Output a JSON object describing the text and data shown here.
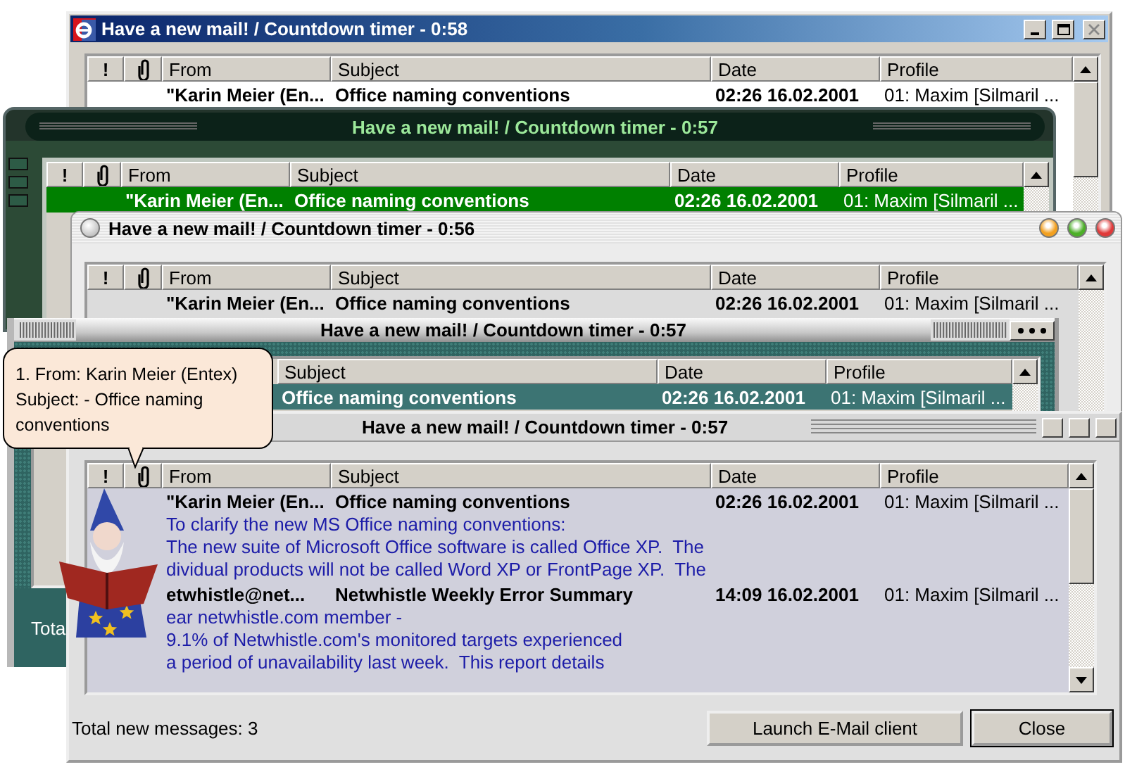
{
  "windows": [
    {
      "kind": "classic",
      "title": "Have a new mail! / Countdown timer - 0:58",
      "columns": [
        {
          "kind": "text",
          "label": "!"
        },
        {
          "kind": "attachment"
        },
        {
          "kind": "text",
          "label": "From"
        },
        {
          "kind": "text",
          "label": "Subject"
        },
        {
          "kind": "text",
          "label": "Date"
        },
        {
          "kind": "text",
          "label": "Profile"
        }
      ],
      "rows": [
        {
          "from": "\"Karin Meier (En...",
          "subject": "Office naming conventions",
          "date": "02:26 16.02.2001",
          "profile": "01: Maxim [Silmaril ...",
          "selected": false
        }
      ]
    },
    {
      "kind": "green",
      "title": "Have a new mail! / Countdown timer - 0:57",
      "columns": [
        {
          "kind": "text",
          "label": "!"
        },
        {
          "kind": "attachment"
        },
        {
          "kind": "text",
          "label": "From"
        },
        {
          "kind": "text",
          "label": "Subject"
        },
        {
          "kind": "text",
          "label": "Date"
        },
        {
          "kind": "text",
          "label": "Profile"
        }
      ],
      "rows": [
        {
          "from": "\"Karin Meier (En...",
          "subject": "Office naming conventions",
          "date": "02:26 16.02.2001",
          "profile": "01: Maxim [Silmaril ...",
          "selected": true
        }
      ]
    },
    {
      "kind": "aqua",
      "title": "Have a new mail! / Countdown timer - 0:56",
      "columns": [
        {
          "kind": "text",
          "label": "!"
        },
        {
          "kind": "attachment"
        },
        {
          "kind": "text",
          "label": "From"
        },
        {
          "kind": "text",
          "label": "Subject"
        },
        {
          "kind": "text",
          "label": "Date"
        },
        {
          "kind": "text",
          "label": "Profile"
        }
      ],
      "rows": [
        {
          "from": "\"Karin Meier (En...",
          "subject": "Office naming conventions",
          "date": "02:26 16.02.2001",
          "profile": "01: Maxim [Silmaril ...",
          "selected": false
        }
      ]
    },
    {
      "kind": "metal",
      "title": "Have a new mail! / Countdown timer - 0:57",
      "columns": [
        {
          "kind": "text",
          "label": "Subject"
        },
        {
          "kind": "text",
          "label": "Date"
        },
        {
          "kind": "text",
          "label": "Profile"
        }
      ],
      "rows": [
        {
          "subject": "Office naming conventions",
          "date": "02:26 16.02.2001",
          "profile": "01: Maxim [Silmaril ...",
          "selected": true
        }
      ],
      "status": "Tota"
    },
    {
      "kind": "gray",
      "title": "Have a new mail! / Countdown timer - 0:57",
      "columns": [
        {
          "kind": "text",
          "label": "!"
        },
        {
          "kind": "attachment"
        },
        {
          "kind": "text",
          "label": "From"
        },
        {
          "kind": "text",
          "label": "Subject"
        },
        {
          "kind": "text",
          "label": "Date"
        },
        {
          "kind": "text",
          "label": "Profile"
        }
      ],
      "rows": [
        {
          "from": "\"Karin Meier (En...",
          "subject": "Office naming conventions",
          "date": "02:26 16.02.2001",
          "profile": "01: Maxim [Silmaril ...",
          "selected": false,
          "preview": [
            "To clarify the new MS Office naming conventions:",
            "The new suite of Microsoft Office software is called Office XP.  The",
            "dividual products will not be called Word XP or FrontPage XP.  The"
          ]
        },
        {
          "from": "etwhistle@net...",
          "subject": "Netwhistle Weekly Error Summary",
          "date": "14:09 16.02.2001",
          "profile": "01: Maxim [Silmaril ...",
          "selected": false,
          "preview": [
            "ear netwhistle.com member -",
            "9.1% of Netwhistle.com's monitored targets experienced",
            "a period of unavailability last week.  This report details"
          ]
        }
      ],
      "status": "Total new messages: 3",
      "buttons": [
        "Launch E-Mail client",
        "Close"
      ]
    }
  ],
  "tooltip": {
    "text": "1. From: Karin Meier (Entex)\nSubject: - Office naming conventions"
  }
}
